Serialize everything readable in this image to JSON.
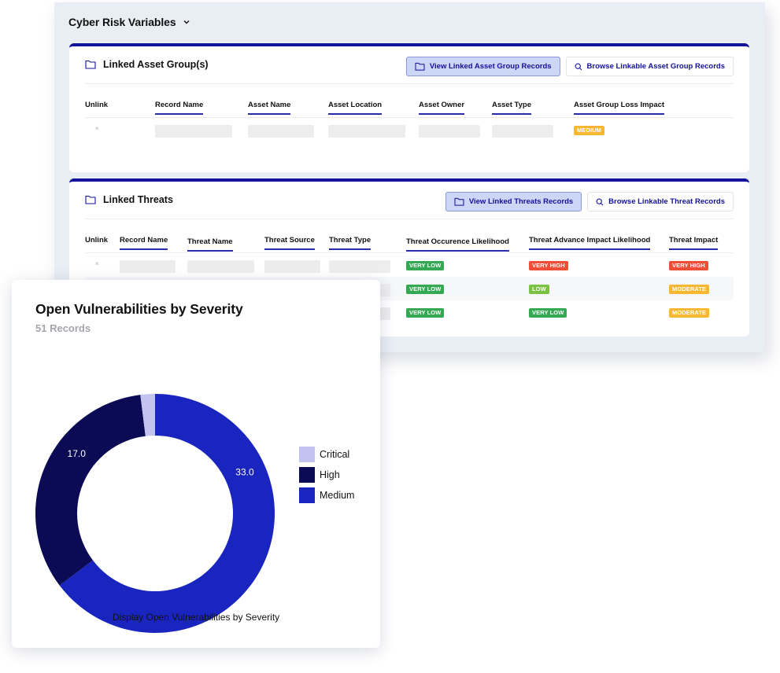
{
  "panel": {
    "title": "Cyber Risk Variables",
    "title_icon": "chevron-down-icon"
  },
  "asset_groups": {
    "title": "Linked Asset Group(s)",
    "title_icon": "folder-icon",
    "view_button": "View Linked Asset Group Records",
    "browse_button": "Browse Linkable Asset Group Records",
    "columns": [
      "Unlink",
      "Record Name",
      "Asset Name",
      "Asset Location",
      "Asset Owner",
      "Asset Type",
      "Asset Group Loss Impact"
    ],
    "rows": [
      {
        "unlink": "×",
        "loss_impact": "MEDIUM"
      }
    ]
  },
  "threats": {
    "title": "Linked Threats",
    "title_icon": "folder-icon",
    "view_button": "View Linked Threats Records",
    "browse_button": "Browse Linkable Threat Records",
    "columns": [
      "Unlink",
      "Record Name",
      "Threat Name",
      "Threat Source",
      "Threat Type",
      "Threat Occurence Likelihood",
      "Threat Advance Impact Likelihood",
      "Threat Impact"
    ],
    "rows": [
      {
        "unlink": "×",
        "occurrence": "VERY LOW",
        "advance": "VERY HIGH",
        "impact": "VERY HIGH"
      },
      {
        "unlink": "",
        "occurrence": "VERY LOW",
        "advance": "LOW",
        "impact": "MODERATE"
      },
      {
        "unlink": "",
        "occurrence": "VERY LOW",
        "advance": "VERY LOW",
        "impact": "MODERATE"
      }
    ]
  },
  "badge_colors": {
    "VERY LOW": "#34a853",
    "LOW": "#7cc242",
    "MEDIUM": "#f7b731",
    "MODERATE": "#f7b731",
    "VERY HIGH": "#f04e37"
  },
  "colors": {
    "accent": "#13129a",
    "panel_bg": "#e9edf4"
  },
  "chart_widget": {
    "title": "Open Vulnerabilities by Severity",
    "subtitle": "51 Records",
    "caption": "Display Open Vulnerabilities by Severity"
  },
  "chart_data": {
    "type": "pie",
    "variant": "donut",
    "title": "Open Vulnerabilities by Severity",
    "subtitle": "51 Records",
    "total": 51,
    "categories": [
      "Critical",
      "High",
      "Medium"
    ],
    "values": [
      1,
      17,
      33
    ],
    "colors": [
      "#c3c3f0",
      "#0a0a55",
      "#1a25c0"
    ],
    "data_labels": [
      "",
      "17.0",
      "33.0"
    ],
    "start_angle_deg": 0,
    "direction": "clockwise",
    "slice_order": [
      "Medium",
      "High",
      "Critical"
    ],
    "legend": {
      "position": "right",
      "entries": [
        "Critical",
        "High",
        "Medium"
      ]
    },
    "caption": "Display Open Vulnerabilities by Severity"
  }
}
